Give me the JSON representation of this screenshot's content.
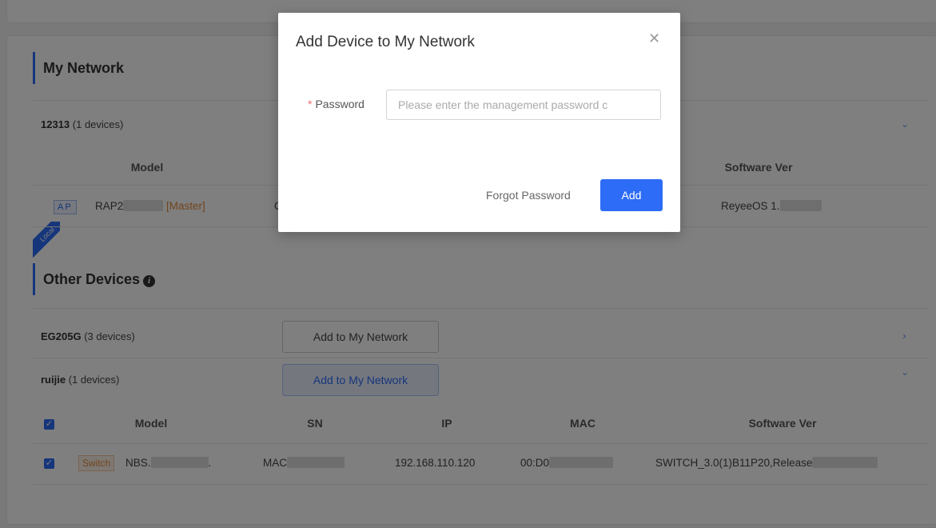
{
  "my_network": {
    "title": "My Network",
    "group": {
      "name": "12313",
      "count": "(1 devices)"
    },
    "columns": [
      "Model",
      "Software Ver"
    ],
    "device": {
      "ribbon": "Local",
      "type_tag": "AP",
      "model_prefix": "RAP2",
      "role": "[Master]",
      "ip_fragment": "C",
      "software_prefix": "ReyeeOS 1."
    }
  },
  "other_devices": {
    "title": "Other Devices",
    "groups": [
      {
        "name": "EG205G",
        "count": "(3 devices)",
        "button": "Add to My Network"
      },
      {
        "name": "ruijie",
        "count": "(1 devices)",
        "button": "Add to My Network"
      }
    ],
    "columns": [
      "Model",
      "SN",
      "IP",
      "MAC",
      "Software Ver"
    ],
    "row": {
      "type_tag": "Switch",
      "model_prefix": "NBS.",
      "model_suffix": ".",
      "sn_prefix": "MAC",
      "ip": "192.168.110.120",
      "mac_prefix": "00:D0",
      "software_prefix": "SWITCH_3.0(1)B11P20,Release"
    }
  },
  "modal": {
    "title": "Add Device to My Network",
    "password_label": "Password",
    "password_placeholder": "Please enter the management password c",
    "forgot_label": "Forgot Password",
    "add_label": "Add"
  },
  "colors": {
    "accent": "#2d6cf6",
    "switch_tag": "#e58a3a"
  }
}
